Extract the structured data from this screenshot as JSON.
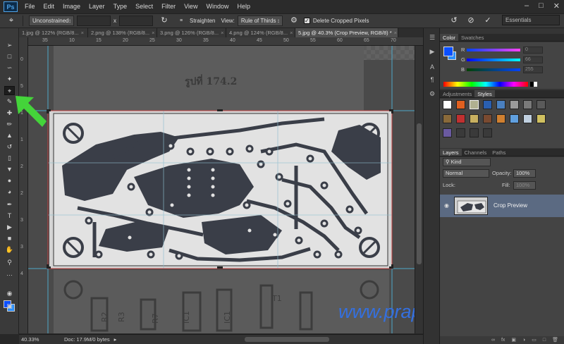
{
  "app": {
    "logo": "Ps",
    "menu": [
      "File",
      "Edit",
      "Image",
      "Layer",
      "Type",
      "Select",
      "Filter",
      "View",
      "Window",
      "Help"
    ],
    "workspace": "Essentials"
  },
  "options_bar": {
    "ratio": "Unconstrained",
    "multiply": "x",
    "straighten_label": "Straighten",
    "view_label": "View:",
    "overlay": "Rule of Thirds",
    "delete_cropped_label": "Delete Cropped Pixels",
    "delete_cropped_checked": true
  },
  "tabs": [
    {
      "label": "1.jpg @ 122% (RGB/8...",
      "close": "×"
    },
    {
      "label": "2.png @ 138% (RGB/8...",
      "close": "×"
    },
    {
      "label": "3.png @ 126% (RGB/8...",
      "close": "×"
    },
    {
      "label": "4.png @ 124% (RGB/8...",
      "close": "×"
    },
    {
      "label": "5.jpg @ 40.3% (Crop Preview, RGB/8) *",
      "close": "×"
    }
  ],
  "ruler": {
    "top": [
      "35",
      "10",
      "15",
      "20",
      "25",
      "30",
      "35",
      "40",
      "45",
      "50",
      "55",
      "60",
      "65",
      "70"
    ],
    "left": [
      "0",
      "5",
      "1",
      "1",
      "2",
      "2",
      "3",
      "3",
      "4"
    ]
  },
  "canvas": {
    "caption": "รูปที่ 174.2",
    "watermark": "www.praphas.com"
  },
  "status": {
    "zoom": "40.33%",
    "doc": "Doc: 17.9M/0 bytes"
  },
  "color_panel": {
    "tabs": [
      "Color",
      "Swatches"
    ],
    "channels": [
      {
        "name": "R",
        "value": "0"
      },
      {
        "name": "G",
        "value": "66"
      },
      {
        "name": "B",
        "value": "255"
      }
    ]
  },
  "styles_panel": {
    "tabs": [
      "Adjustments",
      "Styles"
    ]
  },
  "layers_panel": {
    "tabs": [
      "Layers",
      "Channels",
      "Paths"
    ],
    "filter": "Kind",
    "blend_mode": "Normal",
    "opacity_label": "Opacity:",
    "opacity": "100%",
    "lock_label": "Lock:",
    "fill_label": "Fill:",
    "fill": "100%",
    "layer_name": "Crop Preview"
  },
  "colors": {
    "foreground": "#0a4fff",
    "background": "#2a8fff",
    "watermark": "#3470e0",
    "arrow": "#44d43a",
    "grid": "#4fa8c8"
  }
}
